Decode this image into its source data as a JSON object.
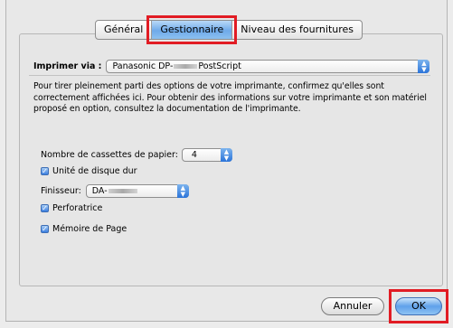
{
  "tabs": [
    {
      "label": "Général",
      "selected": false
    },
    {
      "label": "Gestionnaire",
      "selected": true
    },
    {
      "label": "Niveau des fournitures",
      "selected": false
    }
  ],
  "print_via": {
    "label": "Imprimer via :",
    "value_prefix": "Panasonic DP-",
    "value_suffix": "PostScript"
  },
  "description": "Pour tirer pleinement parti des options de votre imprimante, confirmez qu'elles sont correctement affichées ici. Pour obtenir des informations sur votre imprimante et son matériel proposé en option, consultez la documentation de l'imprimante.",
  "options": {
    "cassettes_label": "Nombre de cassettes de papier:",
    "cassettes_value": "4",
    "hard_disk_label": "Unité de disque dur",
    "hard_disk_checked": true,
    "finisher_label": "Finisseur:",
    "finisher_value_prefix": "DA-",
    "perforator_label": "Perforatrice",
    "perforator_checked": true,
    "page_memory_label": "Mémoire de Page",
    "page_memory_checked": true
  },
  "buttons": {
    "cancel": "Annuler",
    "ok": "OK"
  },
  "colors": {
    "highlight_frame": "#e11c24",
    "selected_blue": "#6eaaea"
  }
}
